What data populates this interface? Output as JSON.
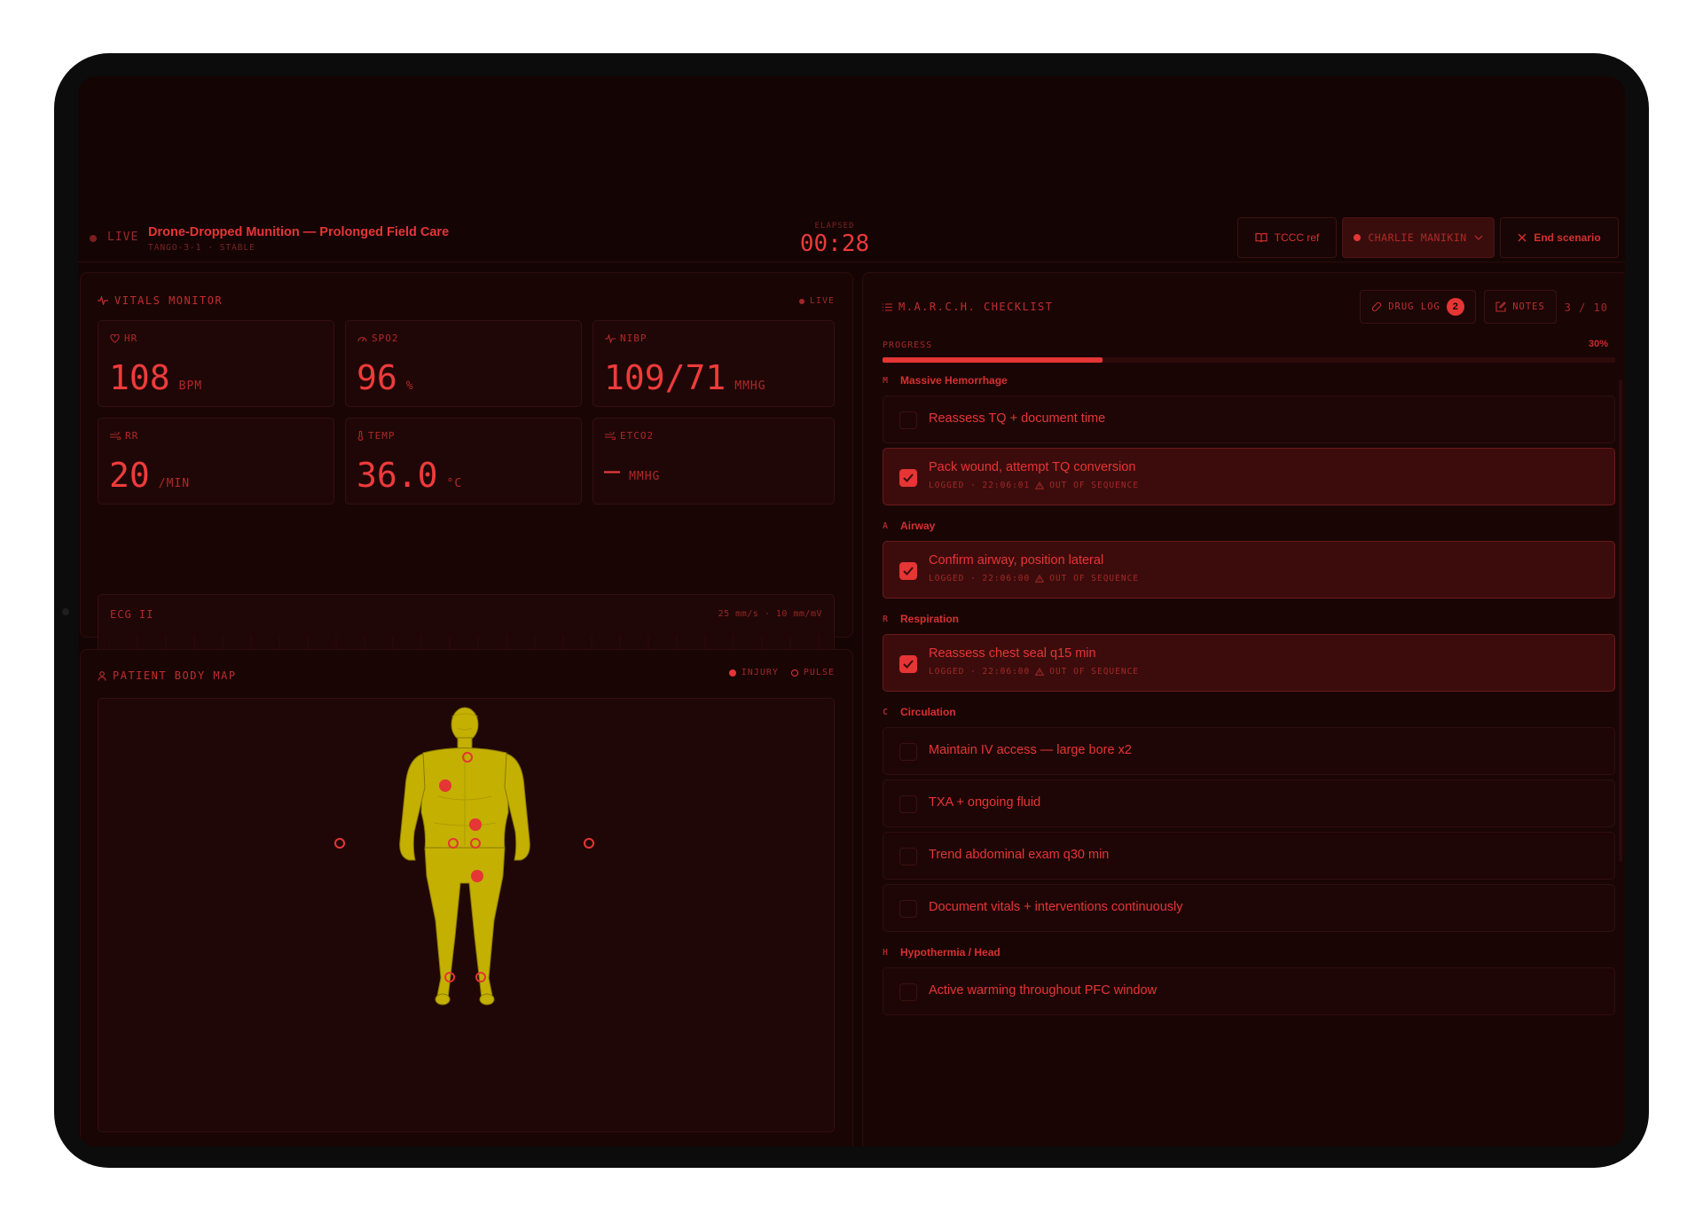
{
  "header": {
    "live_label": "LIVE",
    "scenario_title": "Drone-Dropped Munition — Prolonged Field Care",
    "scenario_sub": "TANGO-3-1 · STABLE",
    "elapsed_label": "ELAPSED",
    "elapsed_value": "00:28",
    "tccc_label": "TCCC ref",
    "patient_label": "CHARLIE MANIKIN",
    "end_label": "End scenario"
  },
  "vitals": {
    "title": "VITALS MONITOR",
    "live": "LIVE",
    "hr": {
      "label": "HR",
      "value": "108",
      "unit": "BPM"
    },
    "spo2": {
      "label": "SPO2",
      "value": "96",
      "unit": "%"
    },
    "nibp": {
      "label": "NIBP",
      "value": "109/71",
      "unit": "MMHG"
    },
    "rr": {
      "label": "RR",
      "value": "20",
      "unit": "/MIN"
    },
    "temp": {
      "label": "TEMP",
      "value": "36.0",
      "unit": "°C"
    },
    "etco2": {
      "label": "ETCO2",
      "value": "—",
      "unit": "MMHG"
    },
    "ecg": {
      "label": "ECG II",
      "rate": "25 mm/s · 10 mm/mV"
    }
  },
  "bodymap": {
    "title": "PATIENT BODY MAP",
    "legend_injury": "INJURY",
    "legend_pulse": "PULSE"
  },
  "march": {
    "title": "M.A.R.C.H. CHECKLIST",
    "drug_log": "DRUG LOG",
    "drug_count": "2",
    "notes": "NOTES",
    "count": "3 / 10",
    "progress_label": "PROGRESS",
    "progress_text": "30%",
    "progress_fraction": 0.3,
    "sections": {
      "m": {
        "letter": "M",
        "name": "Massive Hemorrhage"
      },
      "a": {
        "letter": "A",
        "name": "Airway"
      },
      "r": {
        "letter": "R",
        "name": "Respiration"
      },
      "c": {
        "letter": "C",
        "name": "Circulation"
      },
      "h": {
        "letter": "H",
        "name": "Hypothermia / Head"
      }
    },
    "items": [
      {
        "text": "Reassess TQ + document time",
        "done": false
      },
      {
        "text": "Pack wound, attempt TQ conversion",
        "done": true,
        "logged": "LOGGED · 22:06:01",
        "flag": "OUT OF SEQUENCE"
      },
      {
        "text": "Confirm airway, position lateral",
        "done": true,
        "logged": "LOGGED · 22:06:00",
        "flag": "OUT OF SEQUENCE"
      },
      {
        "text": "Reassess chest seal q15 min",
        "done": true,
        "logged": "LOGGED · 22:06:00",
        "flag": "OUT OF SEQUENCE"
      },
      {
        "text": "Maintain IV access — large bore x2",
        "done": false
      },
      {
        "text": "TXA + ongoing fluid",
        "done": false
      },
      {
        "text": "Trend abdominal exam q30 min",
        "done": false
      },
      {
        "text": "Document vitals + interventions continuously",
        "done": false
      },
      {
        "text": "Active warming throughout PFC window",
        "done": false
      }
    ]
  },
  "colors": {
    "accent": "#e53535",
    "background": "#150404",
    "panel": "#1a0505",
    "body": "#c4b000"
  }
}
